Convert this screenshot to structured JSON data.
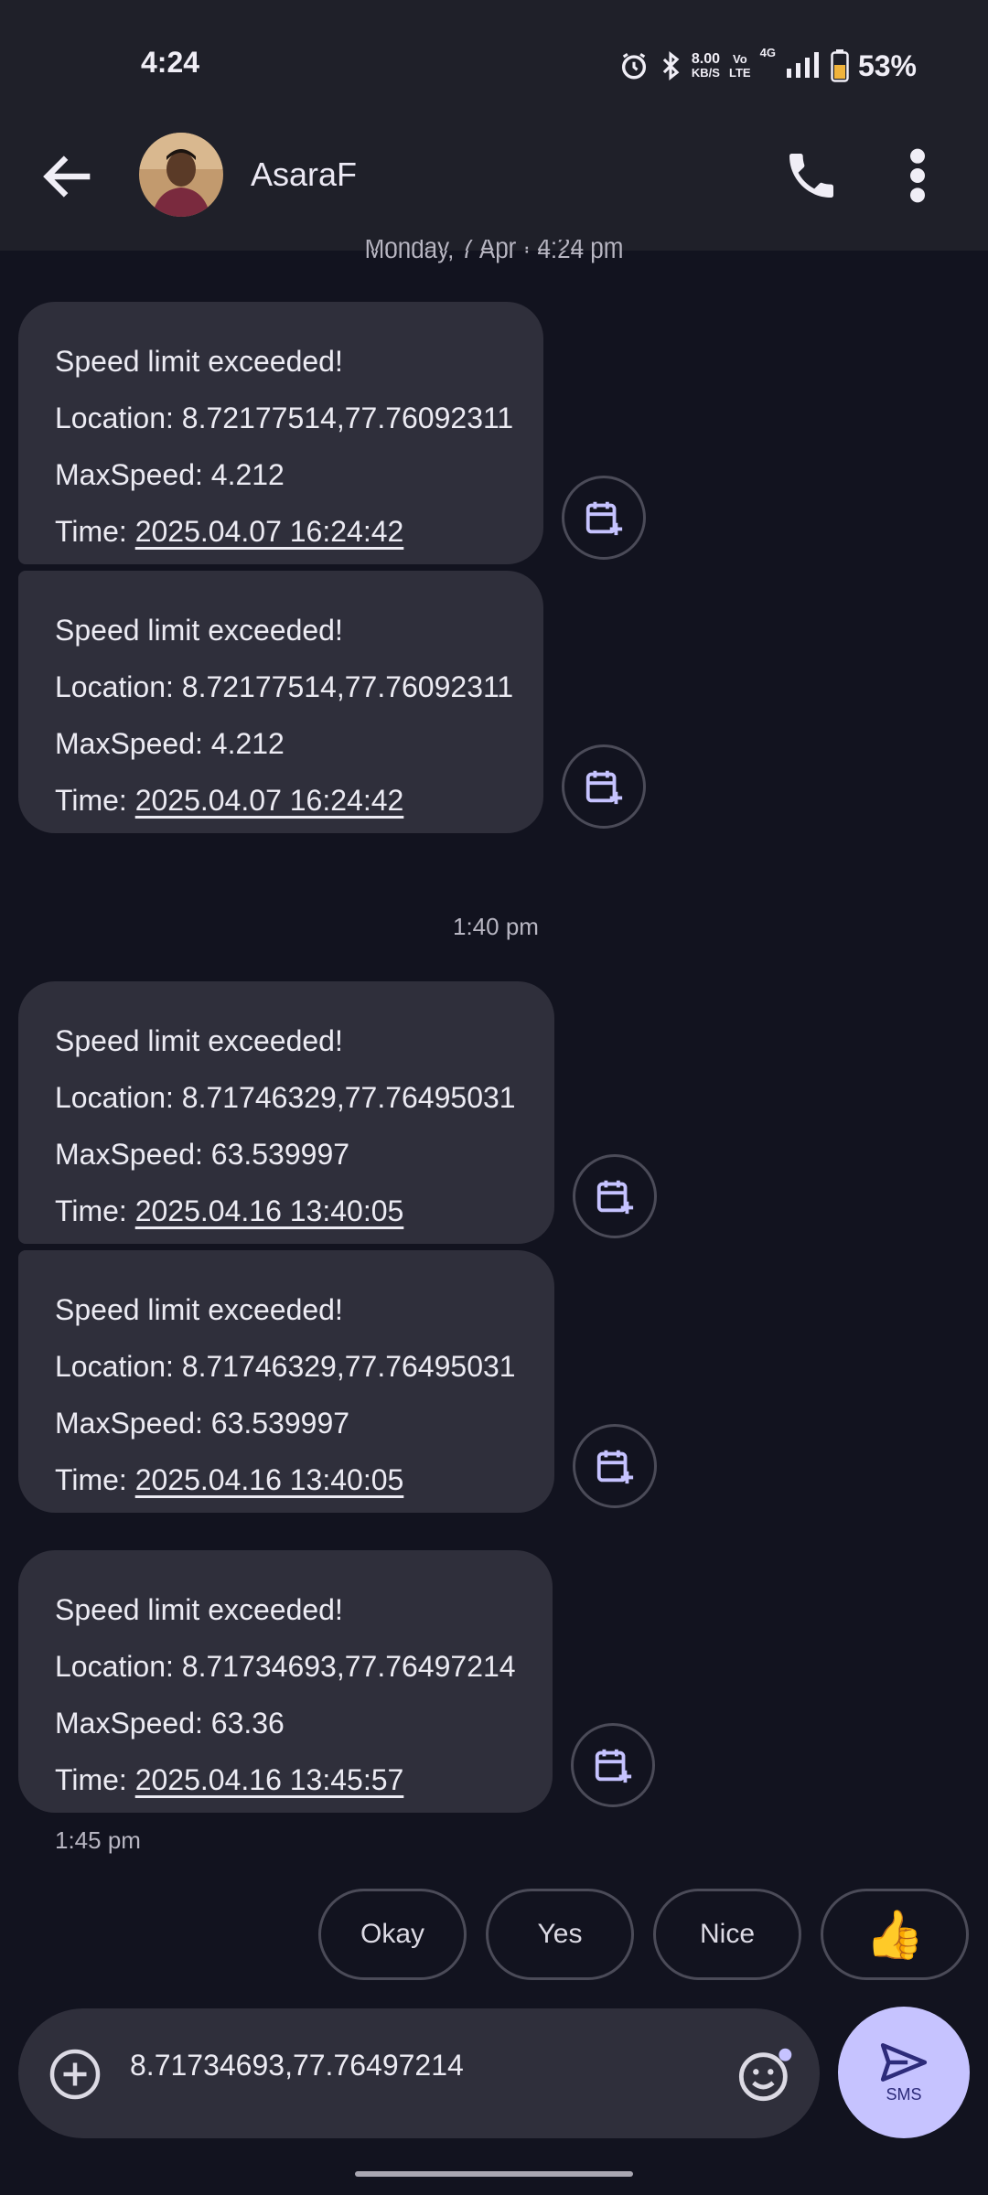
{
  "status_bar": {
    "time": "4:24",
    "net_speed_value": "8.00",
    "net_speed_unit": "KB/S",
    "volte_top": "Vo",
    "volte_bottom": "LTE",
    "network": "4G",
    "battery": "53%"
  },
  "header": {
    "contact_name": "AsaraF",
    "date_header": "Monday, 7 Apr · 4:24 pm"
  },
  "messages": [
    {
      "title": "Speed limit exceeded!",
      "location_label": "Location: ",
      "location": "8.72177514,77.76092311",
      "speed_label": "MaxSpeed: ",
      "speed": "4.212",
      "time_label": "Time: ",
      "time": "2025.04.07 16:24:42"
    },
    {
      "title": "Speed limit exceeded!",
      "location_label": "Location: ",
      "location": "8.72177514,77.76092311",
      "speed_label": "MaxSpeed: ",
      "speed": "4.212",
      "time_label": "Time: ",
      "time": "2025.04.07 16:24:42"
    },
    {
      "title": "Speed limit exceeded!",
      "location_label": "Location: ",
      "location": "8.71746329,77.76495031",
      "speed_label": "MaxSpeed: ",
      "speed": "63.539997",
      "time_label": "Time: ",
      "time": "2025.04.16 13:40:05"
    },
    {
      "title": "Speed limit exceeded!",
      "location_label": "Location: ",
      "location": "8.71746329,77.76495031",
      "speed_label": "MaxSpeed: ",
      "speed": "63.539997",
      "time_label": "Time: ",
      "time": "2025.04.16 13:40:05"
    },
    {
      "title": "Speed limit exceeded!",
      "location_label": "Location: ",
      "location": "8.71734693,77.76497214",
      "speed_label": "MaxSpeed: ",
      "speed": "63.36",
      "time_label": "Time: ",
      "time": "2025.04.16 13:45:57"
    }
  ],
  "separators": {
    "mid_time": "1:40 pm",
    "last_time": "1:45 pm"
  },
  "smart_replies": [
    "Okay",
    "Yes",
    "Nice",
    "👍"
  ],
  "composer": {
    "input_value": "8.71734693,77.76497214",
    "send_label": "SMS"
  },
  "colors": {
    "background": "#12131f",
    "bubble": "#2f2f3b",
    "accent": "#c6c3ff",
    "icon_accent": "#c6c3ff"
  },
  "icons": {
    "back": "arrow-left-icon",
    "call": "phone-icon",
    "more": "more-vertical-icon",
    "calendar": "calendar-add-icon",
    "add": "plus-circle-icon",
    "emoji": "emoji-icon",
    "send": "send-icon"
  }
}
